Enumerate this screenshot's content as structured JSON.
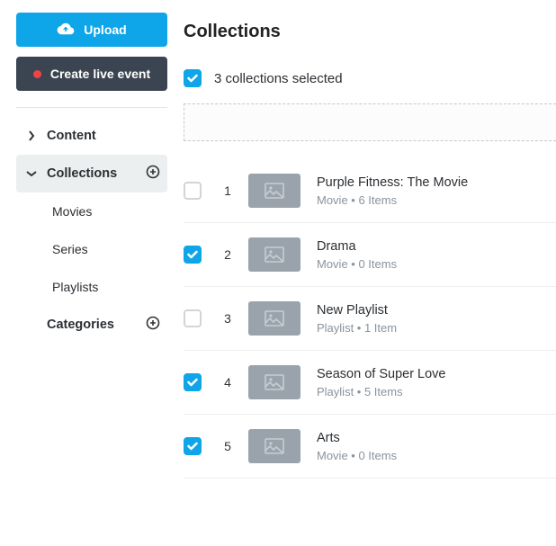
{
  "sidebar": {
    "upload_label": "Upload",
    "live_label": "Create live event",
    "nav": {
      "content": "Content",
      "collections": "Collections",
      "categories": "Categories",
      "sub": {
        "movies": "Movies",
        "series": "Series",
        "playlists": "Playlists"
      }
    }
  },
  "main": {
    "heading": "Collections",
    "selected_label": "3 collections selected",
    "items": [
      {
        "checked": false,
        "index": "1",
        "title": "Purple Fitness: The Movie",
        "subtitle": "Movie • 6 Items"
      },
      {
        "checked": true,
        "index": "2",
        "title": "Drama",
        "subtitle": "Movie • 0 Items"
      },
      {
        "checked": false,
        "index": "3",
        "title": "New Playlist",
        "subtitle": "Playlist • 1 Item"
      },
      {
        "checked": true,
        "index": "4",
        "title": "Season of Super Love",
        "subtitle": "Playlist • 5 Items"
      },
      {
        "checked": true,
        "index": "5",
        "title": "Arts",
        "subtitle": "Movie • 0 Items"
      }
    ]
  }
}
